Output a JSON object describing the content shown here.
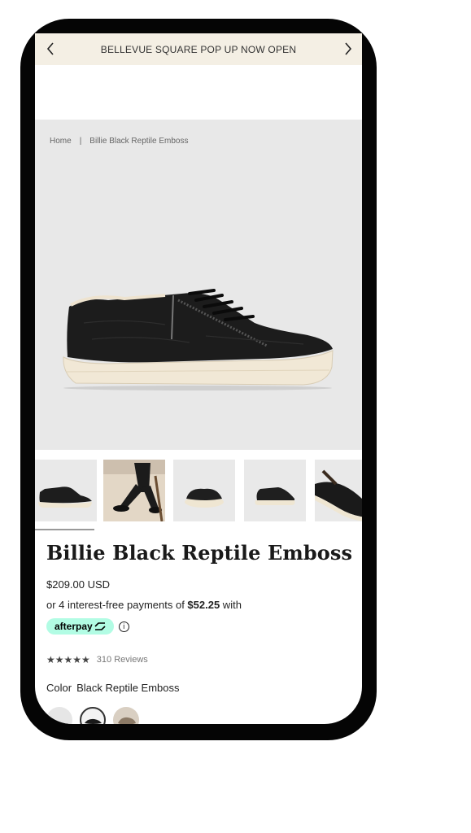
{
  "announcement": {
    "text": "BELLEVUE SQUARE POP UP NOW OPEN",
    "prev_icon": "chevron-left-icon",
    "next_icon": "chevron-right-icon"
  },
  "breadcrumb": {
    "home": "Home",
    "separator": "|",
    "current": "Billie Black Reptile Emboss"
  },
  "product": {
    "title": "Billie Black Reptile Emboss",
    "price": "$209.00 USD",
    "installment_prefix": "or 4 interest-free payments of ",
    "installment_amount": "$52.25",
    "installment_suffix": " with",
    "afterpay_label": "afterpay",
    "afterpay_color": "#b2fce4",
    "info_icon": "info-icon",
    "rating_stars": "★★★★★",
    "reviews": "310 Reviews",
    "color_label": "Color",
    "color_value": "Black Reptile Emboss"
  },
  "thumbnails": {
    "count_visible": 5,
    "active_index": 0
  },
  "colors": {
    "announcement_bg": "#f4efe4",
    "hero_bg": "#e8e8e8",
    "phone_frame": "#050505"
  }
}
